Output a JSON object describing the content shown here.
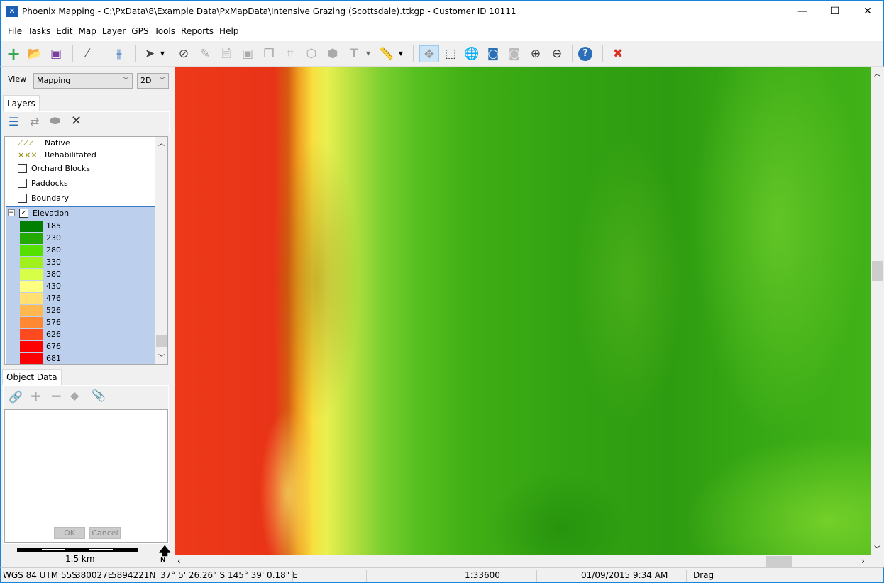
{
  "window": {
    "title": "Phoenix Mapping - C:\\PxData\\8\\Example Data\\PxMapData\\Intensive Grazing (Scottsdale).ttkgp - Customer ID 10111",
    "minimize": "—",
    "maximize": "☐",
    "close": "✕"
  },
  "menu": [
    "File",
    "Tasks",
    "Edit",
    "Map",
    "Layer",
    "GPS",
    "Tools",
    "Reports",
    "Help"
  ],
  "toolbar": {
    "icons": [
      "add-icon",
      "open-icon",
      "save-icon",
      "magic-wand-icon",
      "settings-sliders-icon",
      "select-arrow-icon",
      "deselect-icon",
      "pencil-icon",
      "edit-document-icon",
      "frame-icon",
      "copy-icon",
      "crop-icon",
      "split-icon",
      "merge-icon",
      "text-icon",
      "ruler-icon",
      "pan-icon",
      "zoom-box-icon",
      "globe-icon",
      "globe-extent-icon",
      "globe-disabled-icon",
      "zoom-in-icon",
      "zoom-out-icon",
      "help-icon",
      "close-x-icon"
    ]
  },
  "view": {
    "label": "View",
    "mode": "Mapping",
    "dimension": "2D"
  },
  "layers": {
    "tab": "Layers",
    "legend_sub": [
      "Native",
      "Rehabilitated"
    ],
    "items": [
      {
        "label": "Orchard Blocks",
        "checked": false
      },
      {
        "label": "Paddocks",
        "checked": false
      },
      {
        "label": "Boundary",
        "checked": false
      }
    ],
    "elevation": {
      "label": "Elevation",
      "checked": true,
      "expand": "−",
      "classes": [
        {
          "value": "185",
          "color": "#007f00"
        },
        {
          "value": "230",
          "color": "#22aa00"
        },
        {
          "value": "280",
          "color": "#55e000"
        },
        {
          "value": "330",
          "color": "#a0f020"
        },
        {
          "value": "380",
          "color": "#d8ff48"
        },
        {
          "value": "430",
          "color": "#ffff80"
        },
        {
          "value": "476",
          "color": "#ffe070"
        },
        {
          "value": "526",
          "color": "#ffb850"
        },
        {
          "value": "576",
          "color": "#ff8833"
        },
        {
          "value": "626",
          "color": "#ff4a20"
        },
        {
          "value": "676",
          "color": "#ff0000"
        },
        {
          "value": "681",
          "color": "#ff0000"
        }
      ]
    }
  },
  "object_data": {
    "tab": "Object Data",
    "ok": "OK",
    "cancel": "Cancel"
  },
  "scale": {
    "label": "1.5 km",
    "north": "N"
  },
  "status": {
    "crs": "WGS 84 UTM 55S",
    "easting": "380027E",
    "northing": "5894221N",
    "latlon": "37° 5' 26.26\" S 145° 39' 0.18\" E",
    "scale": "1:33600",
    "datetime": "01/09/2015 9:34 AM",
    "mode": "Drag"
  }
}
